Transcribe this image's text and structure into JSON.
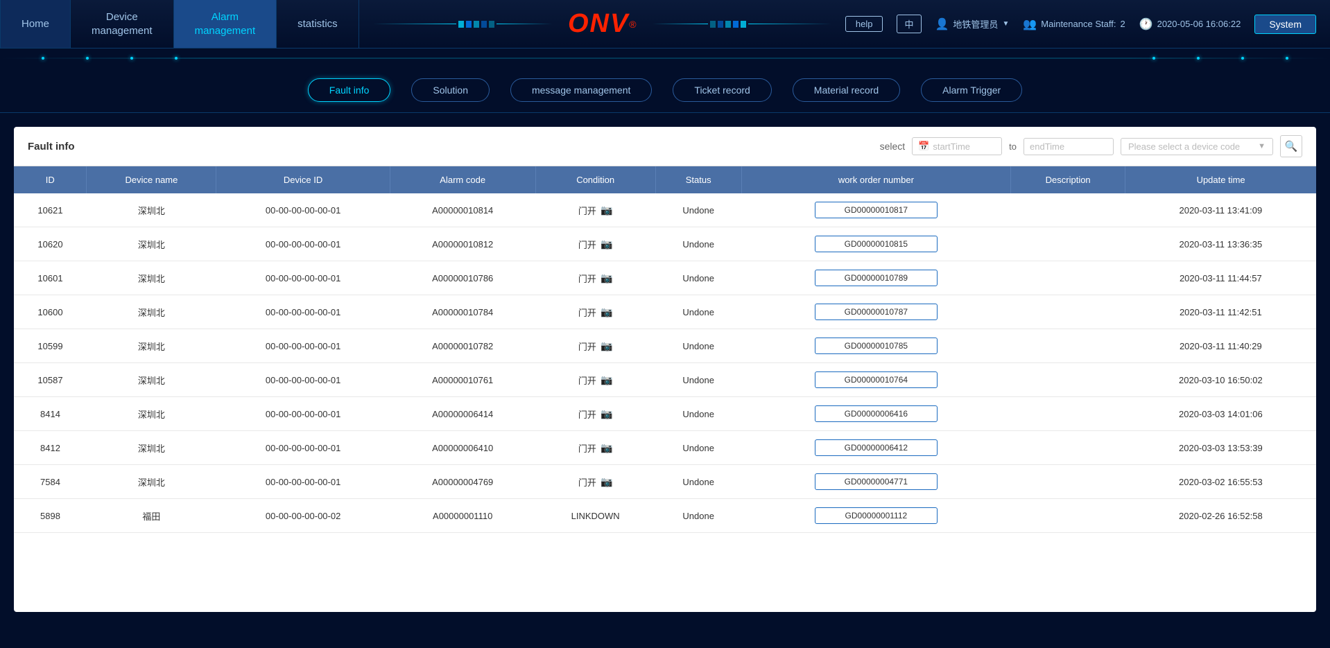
{
  "nav": {
    "tabs": [
      {
        "label": "Home",
        "active": false
      },
      {
        "label": "Device\nmanagement",
        "active": false
      },
      {
        "label": "Alarm\nmanagement",
        "active": true
      },
      {
        "label": "statistics",
        "active": false
      }
    ],
    "logo": "ONV",
    "logo_reg": "®",
    "right": {
      "help": "help",
      "lang": "中",
      "system": "System",
      "user": "地铁管理员",
      "maintenance_label": "Maintenance Staff:",
      "maintenance_count": "2",
      "datetime": "2020-05-06 16:06:22"
    }
  },
  "sub_nav": {
    "items": [
      {
        "label": "Fault info",
        "active": true
      },
      {
        "label": "Solution",
        "active": false
      },
      {
        "label": "message management",
        "active": false
      },
      {
        "label": "Ticket record",
        "active": false
      },
      {
        "label": "Material record",
        "active": false
      },
      {
        "label": "Alarm Trigger",
        "active": false
      }
    ]
  },
  "content": {
    "title": "Fault info",
    "filter": {
      "label": "select",
      "start_placeholder": "startTime",
      "to_label": "to",
      "end_placeholder": "endTime",
      "device_placeholder": "Please select a device code"
    },
    "table": {
      "columns": [
        "ID",
        "Device name",
        "Device ID",
        "Alarm code",
        "Condition",
        "Status",
        "work order number",
        "Description",
        "Update time"
      ],
      "rows": [
        {
          "id": "10621",
          "device_name": "深圳北",
          "device_id": "00-00-00-00-00-01",
          "alarm_code": "A00000010814",
          "condition": "门开",
          "status": "Undone",
          "work_order": "GD00000010817",
          "description": "",
          "update_time": "2020-03-11 13:41:09"
        },
        {
          "id": "10620",
          "device_name": "深圳北",
          "device_id": "00-00-00-00-00-01",
          "alarm_code": "A00000010812",
          "condition": "门开",
          "status": "Undone",
          "work_order": "GD00000010815",
          "description": "",
          "update_time": "2020-03-11 13:36:35"
        },
        {
          "id": "10601",
          "device_name": "深圳北",
          "device_id": "00-00-00-00-00-01",
          "alarm_code": "A00000010786",
          "condition": "门开",
          "status": "Undone",
          "work_order": "GD00000010789",
          "description": "",
          "update_time": "2020-03-11 11:44:57"
        },
        {
          "id": "10600",
          "device_name": "深圳北",
          "device_id": "00-00-00-00-00-01",
          "alarm_code": "A00000010784",
          "condition": "门开",
          "status": "Undone",
          "work_order": "GD00000010787",
          "description": "",
          "update_time": "2020-03-11 11:42:51"
        },
        {
          "id": "10599",
          "device_name": "深圳北",
          "device_id": "00-00-00-00-00-01",
          "alarm_code": "A00000010782",
          "condition": "门开",
          "status": "Undone",
          "work_order": "GD00000010785",
          "description": "",
          "update_time": "2020-03-11 11:40:29"
        },
        {
          "id": "10587",
          "device_name": "深圳北",
          "device_id": "00-00-00-00-00-01",
          "alarm_code": "A00000010761",
          "condition": "门开",
          "status": "Undone",
          "work_order": "GD00000010764",
          "description": "",
          "update_time": "2020-03-10 16:50:02"
        },
        {
          "id": "8414",
          "device_name": "深圳北",
          "device_id": "00-00-00-00-00-01",
          "alarm_code": "A00000006414",
          "condition": "门开",
          "status": "Undone",
          "work_order": "GD00000006416",
          "description": "",
          "update_time": "2020-03-03 14:01:06"
        },
        {
          "id": "8412",
          "device_name": "深圳北",
          "device_id": "00-00-00-00-00-01",
          "alarm_code": "A00000006410",
          "condition": "门开",
          "status": "Undone",
          "work_order": "GD00000006412",
          "description": "",
          "update_time": "2020-03-03 13:53:39"
        },
        {
          "id": "7584",
          "device_name": "深圳北",
          "device_id": "00-00-00-00-00-01",
          "alarm_code": "A00000004769",
          "condition": "门开",
          "status": "Undone",
          "work_order": "GD00000004771",
          "description": "",
          "update_time": "2020-03-02 16:55:53"
        },
        {
          "id": "5898",
          "device_name": "福田",
          "device_id": "00-00-00-00-00-02",
          "alarm_code": "A00000001110",
          "condition": "LINKDOWN",
          "status": "Undone",
          "work_order": "GD00000001112",
          "description": "",
          "update_time": "2020-02-26 16:52:58"
        }
      ]
    }
  }
}
